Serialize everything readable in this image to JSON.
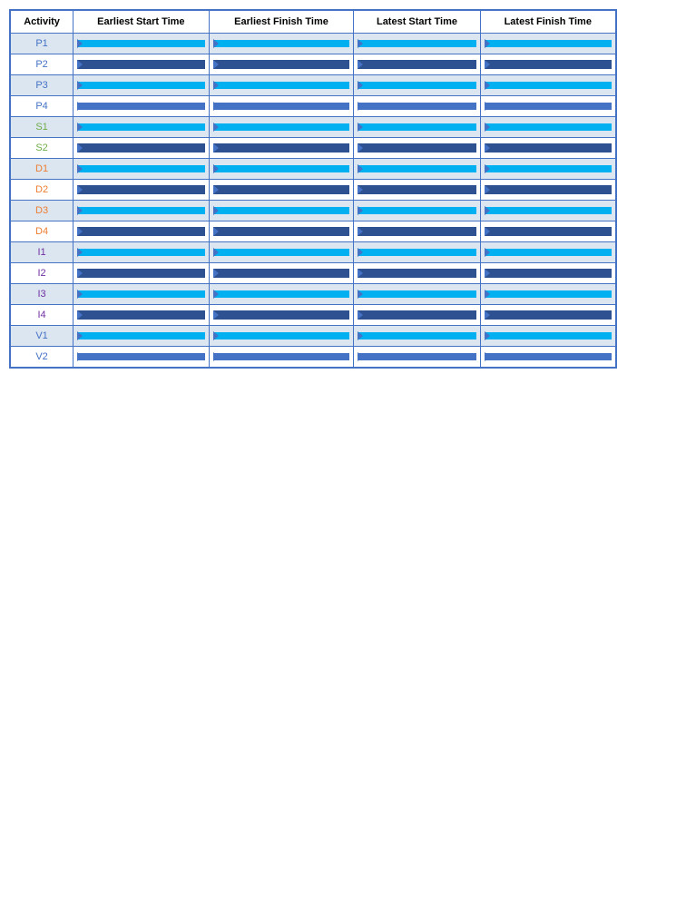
{
  "table": {
    "headers": [
      "Activity",
      "Earliest Start Time",
      "Earliest Finish Time",
      "Latest Start Time",
      "Latest Finish Time"
    ],
    "rows": [
      {
        "id": "P1",
        "color": "blue"
      },
      {
        "id": "P2",
        "color": "blue"
      },
      {
        "id": "P3",
        "color": "blue"
      },
      {
        "id": "P4",
        "color": "blue"
      },
      {
        "id": "S1",
        "color": "green"
      },
      {
        "id": "S2",
        "color": "green"
      },
      {
        "id": "D1",
        "color": "orange"
      },
      {
        "id": "D2",
        "color": "orange"
      },
      {
        "id": "D3",
        "color": "orange"
      },
      {
        "id": "D4",
        "color": "orange"
      },
      {
        "id": "I1",
        "color": "purple"
      },
      {
        "id": "I2",
        "color": "purple"
      },
      {
        "id": "I3",
        "color": "purple"
      },
      {
        "id": "I4",
        "color": "purple"
      },
      {
        "id": "V1",
        "color": "blue"
      },
      {
        "id": "V2",
        "color": "blue"
      }
    ]
  }
}
